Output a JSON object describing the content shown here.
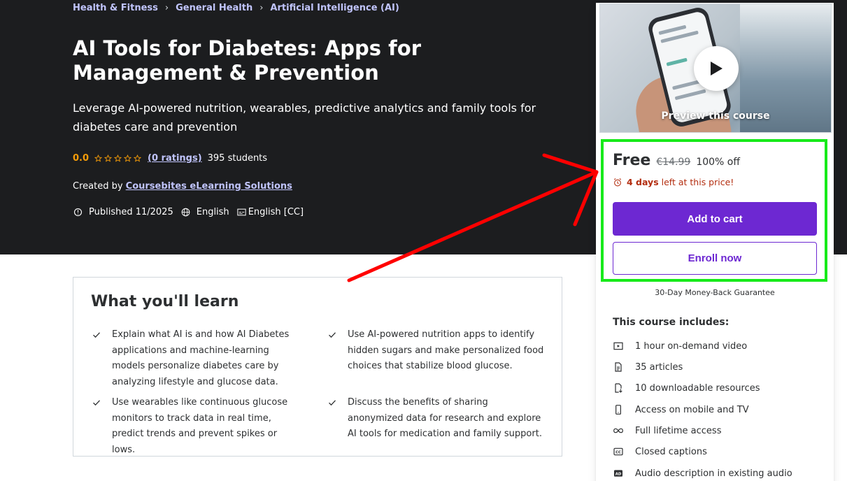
{
  "breadcrumb": [
    "Health & Fitness",
    "General Health",
    "Artificial Intelligence (AI)"
  ],
  "course": {
    "title": "AI Tools for Diabetes: Apps for Management & Prevention",
    "subtitle": "Leverage AI-powered nutrition, wearables, predictive analytics and family tools for diabetes care and prevention",
    "rating": "0.0",
    "stars": 0,
    "ratings_link": "(0 ratings)",
    "students": "395 students",
    "created_by_label": "Created by",
    "instructor": "Coursebites eLearning Solutions",
    "published": "Published 11/2025",
    "language": "English",
    "captions": "English [CC]"
  },
  "learn": {
    "title": "What you'll learn",
    "items": [
      "Explain what AI is and how AI Diabetes applications and machine-learning models personalize diabetes care by analyzing lifestyle and glucose data.",
      "Use AI-powered nutrition apps to identify hidden sugars and make personalized food choices that stabilize blood glucose.",
      "Use wearables like continuous glucose monitors to track data in real time, predict trends and prevent spikes or lows.",
      "Discuss the benefits of sharing anonymized data for research and explore AI tools for medication and family support."
    ]
  },
  "sidebar": {
    "preview_label": "Preview this course",
    "price": "Free",
    "original_price": "€14.99",
    "discount": "100% off",
    "timer_bold": "4 days",
    "timer_rest": "left at this price!",
    "add_to_cart": "Add to cart",
    "enroll_now": "Enroll now",
    "guarantee": "30-Day Money-Back Guarantee",
    "includes_title": "This course includes:",
    "includes": [
      {
        "icon": "video-icon",
        "label": "1 hour on-demand video"
      },
      {
        "icon": "article-icon",
        "label": "35 articles"
      },
      {
        "icon": "download-icon",
        "label": "10 downloadable resources"
      },
      {
        "icon": "mobile-icon",
        "label": "Access on mobile and TV"
      },
      {
        "icon": "infinity-icon",
        "label": "Full lifetime access"
      },
      {
        "icon": "cc-icon",
        "label": "Closed captions"
      },
      {
        "icon": "audio-description-icon",
        "label": "Audio description in existing audio"
      }
    ]
  },
  "colors": {
    "hero_bg": "#1c1d1f",
    "link_purple": "#c0c4fc",
    "brand_purple": "#6d28d2",
    "rating_orange": "#f69c08",
    "timer_red": "#b32d0f",
    "annotation_green": "#17ea1a",
    "annotation_red": "#ff0000"
  }
}
